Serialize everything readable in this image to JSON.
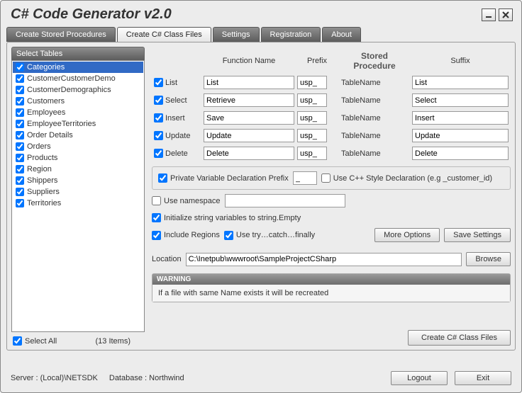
{
  "window": {
    "title": "C# Code Generator v2.0"
  },
  "tabs": [
    "Create Stored Procedures",
    "Create C# Class Files",
    "Settings",
    "Registration",
    "About"
  ],
  "activeTabIndex": 1,
  "tablesPanel": {
    "header": "Select Tables",
    "items": [
      "Categories",
      "CustomerCustomerDemo",
      "CustomerDemographics",
      "Customers",
      "Employees",
      "EmployeeTerritories",
      "Order Details",
      "Orders",
      "Products",
      "Region",
      "Shippers",
      "Suppliers",
      "Territories"
    ],
    "selectAll": "Select All",
    "count": "(13 Items)"
  },
  "columns": {
    "functionName": "Function Name",
    "prefix": "Prefix",
    "storedProcedure": "Stored Procedure",
    "suffix": "Suffix"
  },
  "functions": [
    {
      "label": "List",
      "fname": "List",
      "prefix": "usp_",
      "tn": "TableName",
      "suffix": "List"
    },
    {
      "label": "Select",
      "fname": "Retrieve",
      "prefix": "usp_",
      "tn": "TableName",
      "suffix": "Select"
    },
    {
      "label": "Insert",
      "fname": "Save",
      "prefix": "usp_",
      "tn": "TableName",
      "suffix": "Insert"
    },
    {
      "label": "Update",
      "fname": "Update",
      "prefix": "usp_",
      "tn": "TableName",
      "suffix": "Update"
    },
    {
      "label": "Delete",
      "fname": "Delete",
      "prefix": "usp_",
      "tn": "TableName",
      "suffix": "Delete"
    }
  ],
  "options": {
    "privatePrefixLabel": "Private Variable Declaration Prefix",
    "privatePrefixValue": "_",
    "cppStyleLabel": "Use C++ Style Declaration (e.g _customer_id)",
    "useNamespace": "Use namespace",
    "namespaceValue": "",
    "initStringEmpty": "Initialize string variables to string.Empty",
    "includeRegions": "Include Regions",
    "useTryCatch": "Use try…catch…finally",
    "moreOptions": "More Options",
    "saveSettings": "Save Settings",
    "locationLabel": "Location",
    "locationValue": "C:\\Inetpub\\wwwroot\\SampleProjectCSharp",
    "browse": "Browse"
  },
  "warning": {
    "header": "WARNING",
    "body": "If a file with same Name exists it will be recreated"
  },
  "actions": {
    "create": "Create C# Class Files",
    "logout": "Logout",
    "exit": "Exit"
  },
  "statusbar": {
    "server": "Server : (Local)\\NETSDK",
    "database": "Database : Northwind"
  }
}
